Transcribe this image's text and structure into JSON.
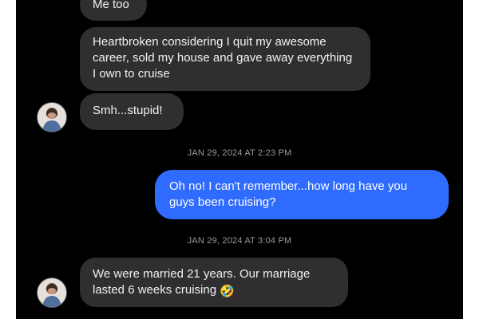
{
  "messages": [
    {
      "text": "Me too"
    },
    {
      "text": "Heartbroken considering I quit my awesome career, sold my house and gave away everything I own to cruise"
    },
    {
      "text": "Smh...stupid!"
    },
    {
      "timestamp": "JAN 29, 2024 AT 2:23 PM"
    },
    {
      "text": "Oh no! I can't remember...how long have you guys been cruising?"
    },
    {
      "timestamp": "JAN 29, 2024 AT 3:04 PM"
    },
    {
      "text": "We were married 21 years. Our marriage lasted 6 weeks cruising"
    }
  ],
  "emoji": "🤣",
  "colors": {
    "background": "#000000",
    "incoming_bubble": "#2f2f31",
    "outgoing_bubble": "#2f6bff",
    "timestamp_text": "#9a9a9a"
  },
  "icons": {
    "contact_avatar": "contact-avatar-icon",
    "laughing_emoji": "rolling-on-floor-laughing-emoji"
  }
}
